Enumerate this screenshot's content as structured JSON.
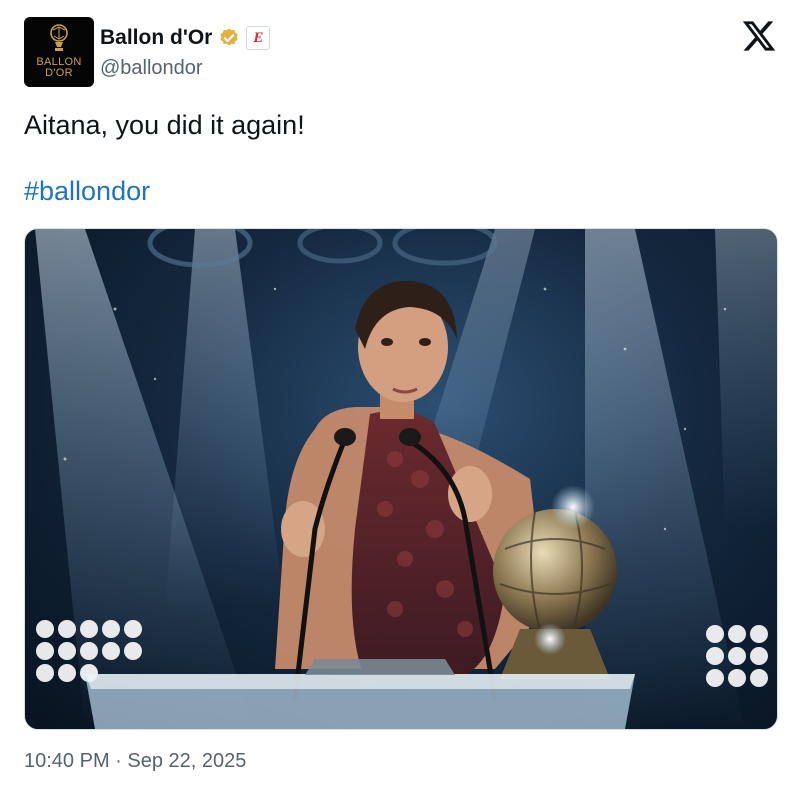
{
  "author": {
    "display_name": "Ballon d'Or",
    "handle": "@ballondor",
    "avatar_text": "BALLON D'OR",
    "verified_icon": "verified-gold-badge-icon",
    "affiliate_badge": "E"
  },
  "tweet": {
    "text": "Aitana, you did it again!",
    "hashtag": "#ballondor",
    "time": "10:40 PM",
    "separator": " · ",
    "date": "Sep 22, 2025"
  },
  "icons": {
    "platform": "x-logo-icon"
  },
  "colors": {
    "link": "#1d74c5",
    "secondary_text": "#536471",
    "verified_gold": "#e2b33c",
    "avatar_bg": "#050505",
    "avatar_gold": "#c9a24a"
  }
}
